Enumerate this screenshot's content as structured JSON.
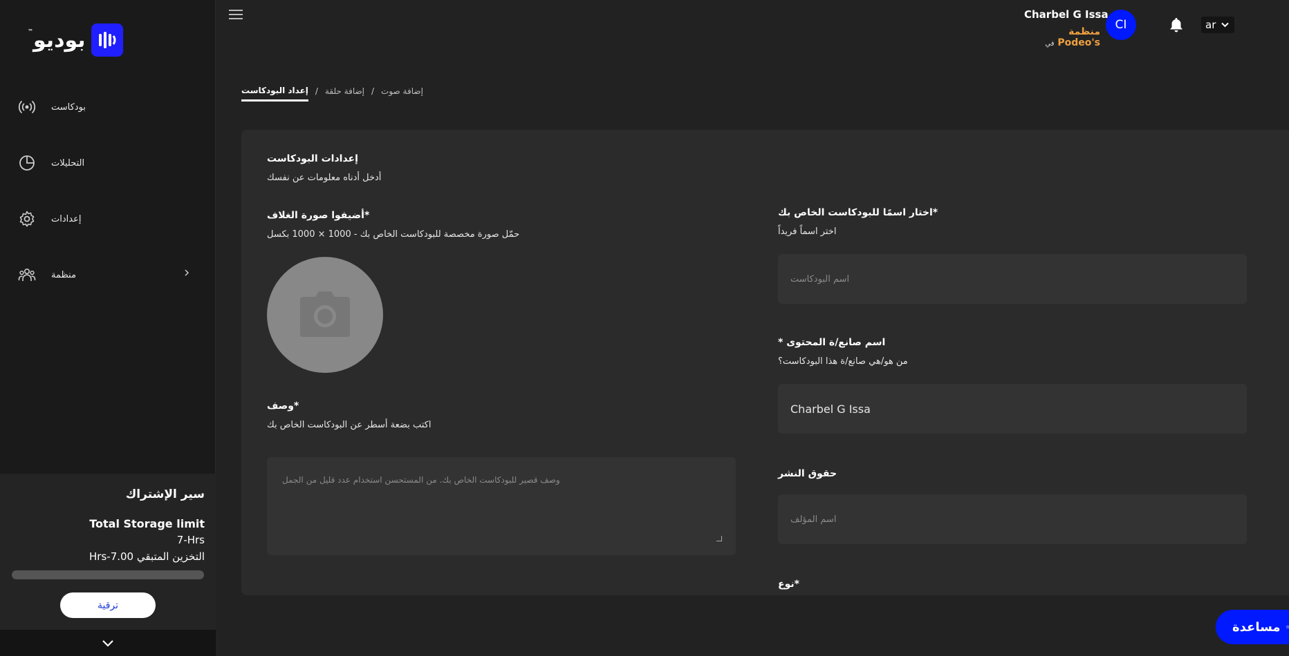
{
  "app": {
    "logo_text": "بوديو",
    "logo_tm": "™"
  },
  "sidebar": {
    "items": [
      {
        "label": "بودكاست",
        "icon": "broadcast-icon"
      },
      {
        "label": "التحليلات",
        "icon": "pie-chart-icon"
      },
      {
        "label": "إعدادات",
        "icon": "gear-icon"
      },
      {
        "label": "منظمة",
        "icon": "group-icon"
      }
    ],
    "subscription": {
      "title": "سير الإشتراك",
      "storage_label": "Total Storage limit",
      "storage_value": "7-Hrs",
      "remaining": "التخزين المتبقي 7.00-Hrs",
      "progress_used": 0,
      "upgrade_label": "ترقية"
    }
  },
  "header": {
    "user_name": "Charbel G Issa",
    "org_prefix": "في",
    "org_name": "منظمة Podeo's",
    "avatar_initials": "CI",
    "language": "ar"
  },
  "breadcrumb": {
    "items": [
      "إعداد البودكاست",
      "إضافة حلقة",
      "إضافة صوت"
    ],
    "separator": "/"
  },
  "form": {
    "section_title": "إعدادات البودكاست",
    "section_subtitle": "أدخل أدناه معلومات عن نفسك",
    "cover": {
      "title": "أضيفوا صورة الغلاف*",
      "subtitle": "حمّل صورة مخصصة للبودكاست الخاص بك - 1000 × 1000 بكسل"
    },
    "description": {
      "title": "وصف*",
      "subtitle": "اكتب بضعة أسطر عن البودكاست الخاص بك",
      "placeholder": "وصف قصير للبودكاست الخاص بك. من المستحسن استخدام عدد قليل من الجمل"
    },
    "name": {
      "title": "اختار اسمًا للبودكاست الخاص بك*",
      "subtitle": "اختر اسماً فريداً",
      "placeholder": "اسم البودكاست"
    },
    "creator": {
      "title": "* اسم صانع/ة المحتوى",
      "subtitle": "من هو/هي صانع/ة هذا البودكاست؟",
      "value": "Charbel G Issa"
    },
    "copyright": {
      "title": "حقوق النشر",
      "placeholder": "اسم المؤلف"
    },
    "type": {
      "title": "نوع*"
    }
  },
  "help": {
    "label": "مساعدة"
  }
}
